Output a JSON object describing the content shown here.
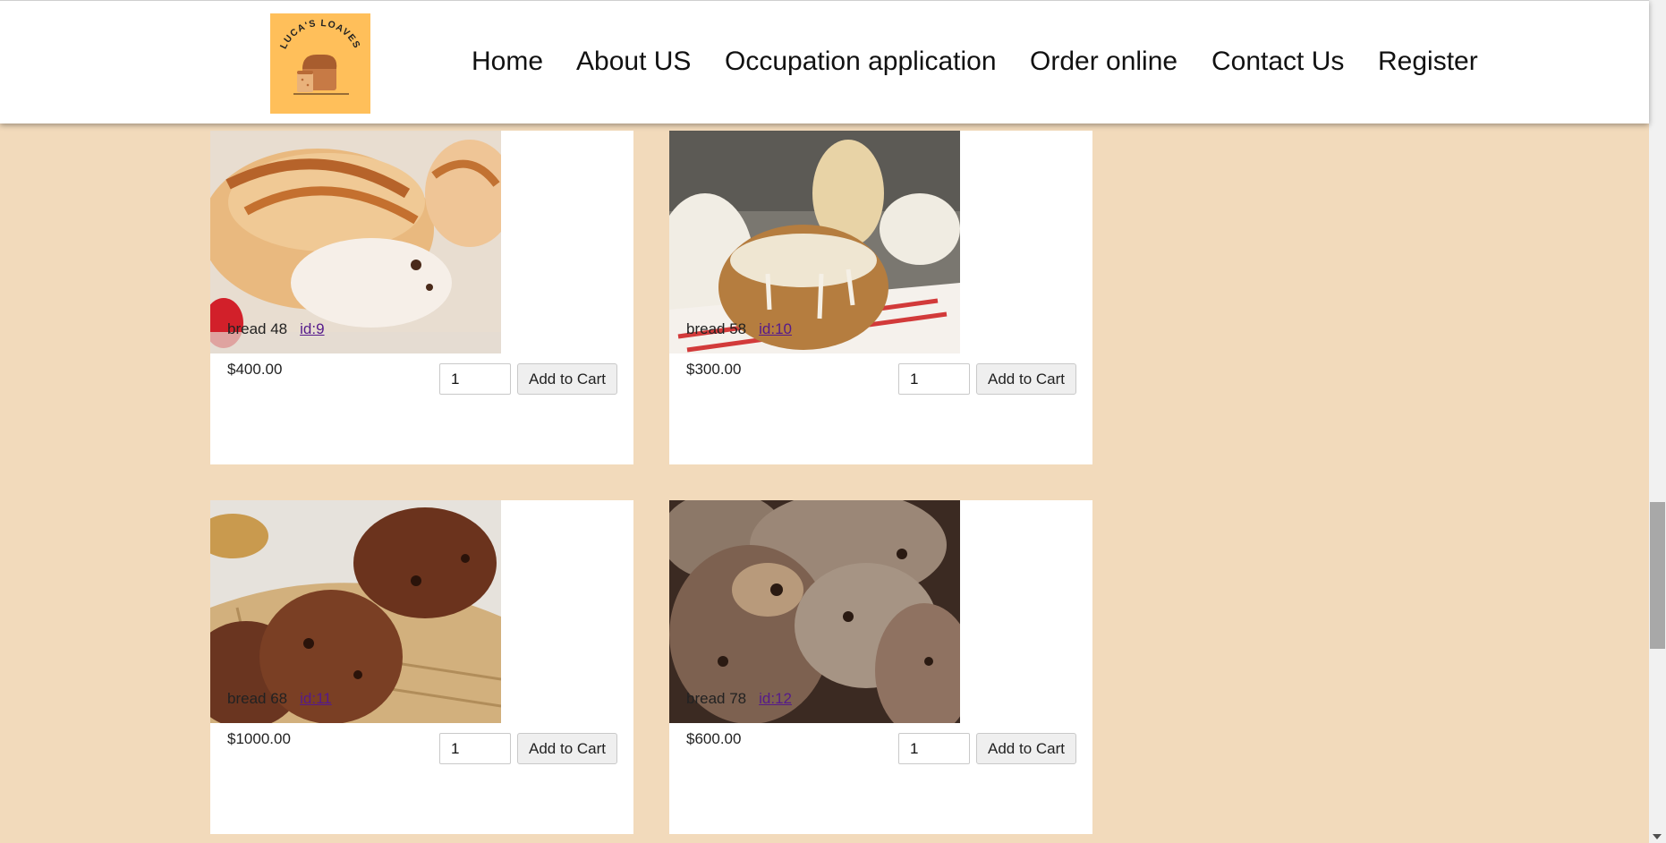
{
  "brand": {
    "logo_text": "LUCA'S LOAVES"
  },
  "nav": {
    "items": [
      {
        "label": "Home"
      },
      {
        "label": "About US"
      },
      {
        "label": "Occupation application"
      },
      {
        "label": "Order online"
      },
      {
        "label": "Contact Us"
      },
      {
        "label": "Register"
      }
    ]
  },
  "products": [
    {
      "name": "bread 48",
      "id_label": "id:9",
      "price": "$400.00",
      "qty": "1",
      "button": "Add to Cart"
    },
    {
      "name": "bread 58",
      "id_label": "id:10",
      "price": "$300.00",
      "qty": "1",
      "button": "Add to Cart"
    },
    {
      "name": "bread 68",
      "id_label": "id:11",
      "price": "$1000.00",
      "qty": "1",
      "button": "Add to Cart"
    },
    {
      "name": "bread 78",
      "id_label": "id:12",
      "price": "$600.00",
      "qty": "1",
      "button": "Add to Cart"
    }
  ],
  "colors": {
    "page_background": "#f2dabb",
    "logo_background": "#ffbf5a",
    "link_visited": "#551a8b"
  }
}
